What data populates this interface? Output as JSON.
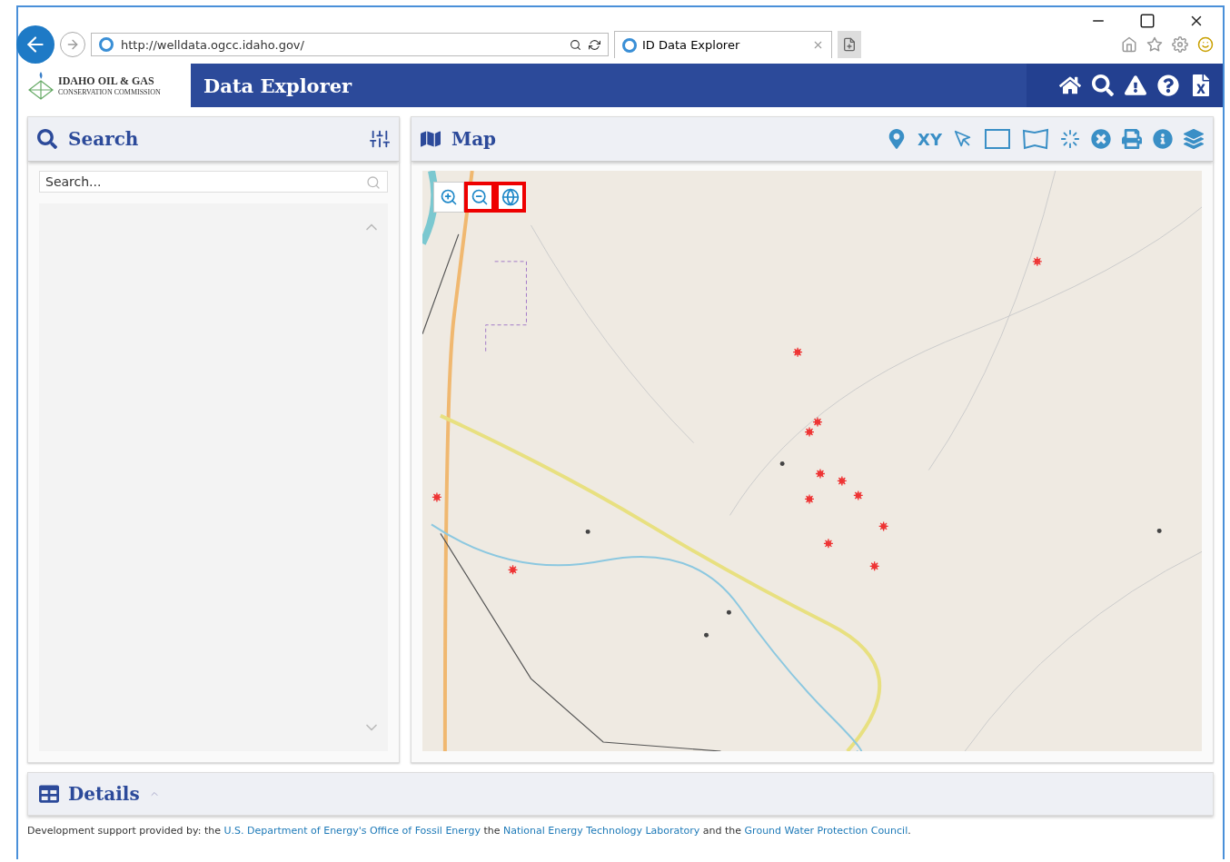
{
  "browser": {
    "address": "http://welldata.ogcc.idaho.gov/",
    "tab_title": "ID Data Explorer"
  },
  "header": {
    "logo_title": "IDAHO OIL & GAS",
    "logo_subtitle": "CONSERVATION COMMISSION",
    "title": "Data Explorer"
  },
  "search_panel": {
    "title": "Search",
    "placeholder": "Search..."
  },
  "map_panel": {
    "title": "Map",
    "xy_tool": "XY",
    "zoom_controls": [
      {
        "kind": "zoom-in",
        "highlighted": false
      },
      {
        "kind": "zoom-out",
        "highlighted": true
      },
      {
        "kind": "globe",
        "highlighted": true
      }
    ]
  },
  "details_panel": {
    "title": "Details"
  },
  "footer": [
    {
      "kind": "text",
      "text": "Development support provided by: the "
    },
    {
      "kind": "link",
      "text": "U.S. Department of Energy's Office of Fossil Energy"
    },
    {
      "kind": "text",
      "text": " the "
    },
    {
      "kind": "link",
      "text": "National Energy Technology Laboratory"
    },
    {
      "kind": "text",
      "text": " and the "
    },
    {
      "kind": "link",
      "text": "Ground Water Protection Council"
    },
    {
      "kind": "text",
      "text": "."
    }
  ]
}
